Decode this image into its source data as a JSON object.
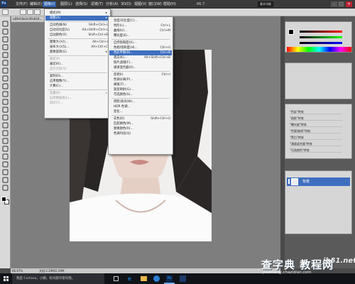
{
  "menubar": {
    "items": [
      "文件(F)",
      "编辑(E)",
      "图像(I)",
      "图层(L)",
      "选择(S)",
      "滤镜(T)",
      "分析(A)",
      "3D(D)",
      "视图(V)",
      "窗口(W)",
      "帮助(H)"
    ],
    "zoom": "66.7",
    "workspace": "基本功能",
    "minimize": "–",
    "maximize": "□",
    "close": "✕"
  },
  "document": {
    "tab_title": "u89e58a2e39c824..."
  },
  "image_menu": {
    "items": [
      {
        "label": "模式(M)",
        "shortcut": "",
        "submenu": true
      },
      {
        "label": "调整(A)",
        "shortcut": "",
        "submenu": true,
        "highlight": true
      },
      {
        "label": "自动色调(N)",
        "shortcut": "Shift+Ctrl+L"
      },
      {
        "label": "自动对比度(U)",
        "shortcut": "Alt+Shift+Ctrl+L"
      },
      {
        "label": "自动颜色(O)",
        "shortcut": "Shift+Ctrl+B"
      },
      {
        "label": "图像大小(I)...",
        "shortcut": "Alt+Ctrl+I"
      },
      {
        "label": "画布大小(S)...",
        "shortcut": "Alt+Ctrl+C"
      },
      {
        "label": "图像旋转(G)",
        "shortcut": "",
        "submenu": true
      },
      {
        "label": "裁剪(P)",
        "shortcut": "",
        "disabled": true
      },
      {
        "label": "裁切(R)...",
        "shortcut": ""
      },
      {
        "label": "显示全部(V)",
        "shortcut": "",
        "disabled": true
      },
      {
        "label": "复制(D)...",
        "shortcut": ""
      },
      {
        "label": "应用图像(Y)...",
        "shortcut": ""
      },
      {
        "label": "计算(C)...",
        "shortcut": ""
      },
      {
        "label": "变量(B)",
        "shortcut": "",
        "submenu": true,
        "disabled": true
      },
      {
        "label": "应用数据组(L)...",
        "shortcut": "",
        "disabled": true
      },
      {
        "label": "陷印(T)...",
        "shortcut": "",
        "disabled": true
      }
    ]
  },
  "adjust_menu": {
    "items": [
      {
        "label": "亮度/对比度(C)...",
        "shortcut": ""
      },
      {
        "label": "色阶(L)...",
        "shortcut": "Ctrl+L"
      },
      {
        "label": "曲线(U)...",
        "shortcut": "Ctrl+M"
      },
      {
        "label": "曝光度(E)...",
        "shortcut": ""
      },
      {
        "label": "自然饱和度(V)...",
        "shortcut": ""
      },
      {
        "label": "色相/饱和度(H)...",
        "shortcut": "Ctrl+U"
      },
      {
        "label": "色彩平衡(B)...",
        "shortcut": "Ctrl+B",
        "highlight": true
      },
      {
        "label": "黑白(K)...",
        "shortcut": "Alt+Shift+Ctrl+B"
      },
      {
        "label": "照片滤镜(F)...",
        "shortcut": ""
      },
      {
        "label": "通道混合器(X)...",
        "shortcut": ""
      },
      {
        "label": "反相(I)",
        "shortcut": "Ctrl+I"
      },
      {
        "label": "色调分离(P)...",
        "shortcut": ""
      },
      {
        "label": "阈值(T)...",
        "shortcut": ""
      },
      {
        "label": "渐变映射(G)...",
        "shortcut": ""
      },
      {
        "label": "可选颜色(S)...",
        "shortcut": ""
      },
      {
        "label": "阴影/高光(W)...",
        "shortcut": ""
      },
      {
        "label": "HDR 色调...",
        "shortcut": ""
      },
      {
        "label": "变化...",
        "shortcut": ""
      },
      {
        "label": "去色(D)",
        "shortcut": "Shift+Ctrl+U"
      },
      {
        "label": "匹配颜色(M)...",
        "shortcut": ""
      },
      {
        "label": "替换颜色(R)...",
        "shortcut": ""
      },
      {
        "label": "色调均化(Q)",
        "shortcut": ""
      }
    ]
  },
  "actions_panel": {
    "items": [
      "\"色彩\"特效",
      "\"画框\"特效",
      "\"曝光度\"特效",
      "\"色版/曲线\"特效",
      "\"黑白\"特效",
      "\"通道混合器\"特效",
      "\"可选颜色\"特效"
    ]
  },
  "layers_panel": {
    "layer_name": "背景"
  },
  "statusbar": {
    "zoom": "66.67%",
    "doc_info": "文档:2.29M/2.29M"
  },
  "taskbar": {
    "search_placeholder": "我是 Cortana，小娜。有问题尽管问我。"
  },
  "watermark": {
    "site": "jb51.net",
    "brand": "查字典 教程网",
    "url": "jiaocheng.chazidian.com"
  },
  "colors": {
    "menu_highlight": "#3e6fbf",
    "menubar_bg": "#3a3a3a",
    "panel_bg": "#d6d6d6"
  }
}
